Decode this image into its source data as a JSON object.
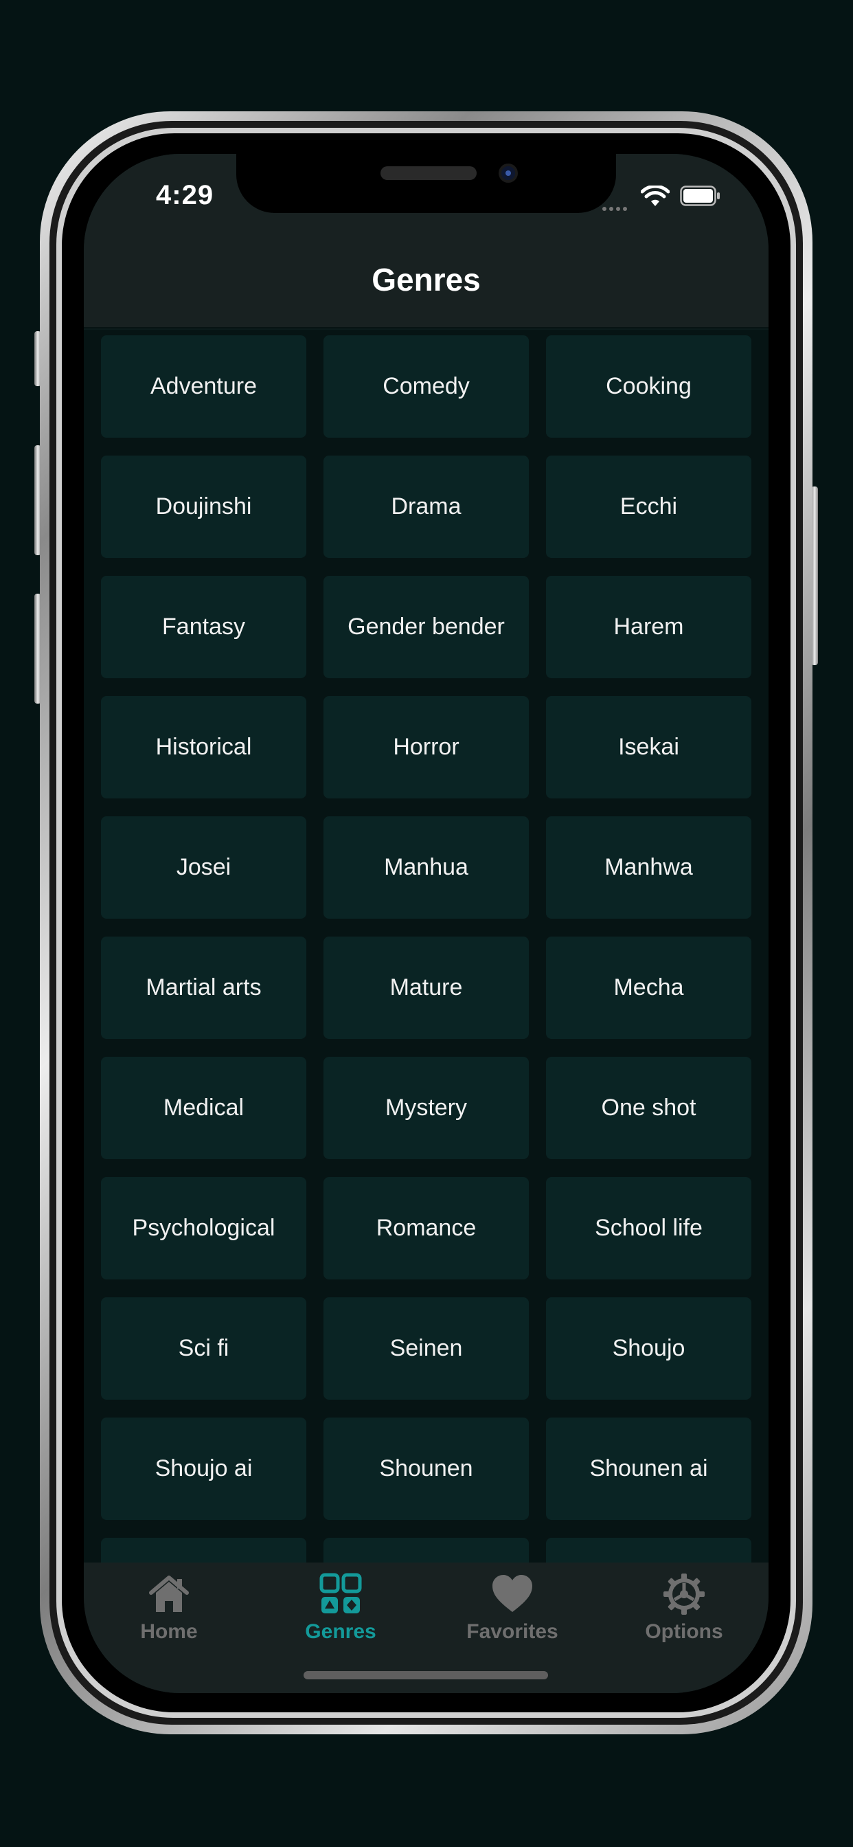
{
  "status_bar": {
    "time": "4:29"
  },
  "header": {
    "title": "Genres"
  },
  "genres": [
    "Adventure",
    "Comedy",
    "Cooking",
    "Doujinshi",
    "Drama",
    "Ecchi",
    "Fantasy",
    "Gender bender",
    "Harem",
    "Historical",
    "Horror",
    "Isekai",
    "Josei",
    "Manhua",
    "Manhwa",
    "Martial arts",
    "Mature",
    "Mecha",
    "Medical",
    "Mystery",
    "One shot",
    "Psychological",
    "Romance",
    "School life",
    "Sci fi",
    "Seinen",
    "Shoujo",
    "Shoujo ai",
    "Shounen",
    "Shounen ai",
    "",
    "",
    ""
  ],
  "tab_bar": {
    "items": [
      {
        "label": "Home",
        "icon": "home-icon",
        "active": false
      },
      {
        "label": "Genres",
        "icon": "grid-icon",
        "active": true
      },
      {
        "label": "Favorites",
        "icon": "heart-icon",
        "active": false
      },
      {
        "label": "Options",
        "icon": "gear-icon",
        "active": false
      }
    ]
  },
  "colors": {
    "accent": "#139a9a",
    "tile": "#0a2424",
    "bar": "#182121",
    "inactive": "#6f6f6f"
  }
}
